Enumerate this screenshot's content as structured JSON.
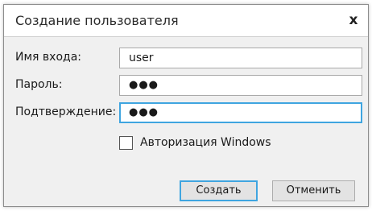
{
  "dialog": {
    "title": "Создание пользователя",
    "close_glyph": "x",
    "close_icon": "close-icon"
  },
  "form": {
    "login_label": "Имя входа:",
    "login_value": "user",
    "password_label": "Пароль:",
    "password_value": "●●●",
    "confirm_label": "Подтверждение:",
    "confirm_value": "●●●",
    "windows_auth_label": "Авторизация Windows",
    "windows_auth_checked": false
  },
  "buttons": {
    "create_label": "Создать",
    "cancel_label": "Отменить"
  },
  "colors": {
    "focus_accent": "#3fa5e0",
    "dialog_bg": "#f0f0f0"
  }
}
